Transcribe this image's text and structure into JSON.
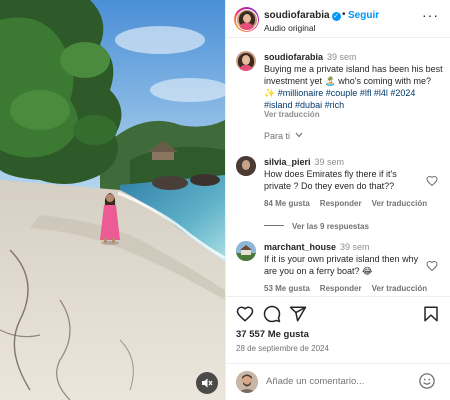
{
  "header": {
    "username": "soudiofarabia",
    "follow_label": "Seguir",
    "audio_label": "Audio original",
    "dot": "•",
    "more_label": "···"
  },
  "caption": {
    "username": "soudiofarabia",
    "time": "39 sem",
    "text_before": "Buying me a private island has been his best investment yet 🏝️ who's coming with me? ✨ ",
    "hashtags": [
      "#millionaire",
      "#couple",
      "#lfl",
      "#l4l",
      "#2024",
      "#island",
      "#dubai",
      "#rich"
    ],
    "translate_label": "Ver traducción"
  },
  "filter": {
    "label": "Para ti"
  },
  "comments": [
    {
      "username": "silvia_pieri",
      "time": "39 sem",
      "text": "How does Emirates fly there if it's private ? Do they even do that??",
      "likes": "84 Me gusta",
      "reply_label": "Responder",
      "translate_label": "Ver traducción",
      "view_replies": "Ver las 9 respuestas"
    },
    {
      "username": "marchant_house",
      "time": "39 sem",
      "text": "If it is your own private island then why are you on a ferry boat? 😂",
      "likes": "53 Me gusta",
      "reply_label": "Responder",
      "translate_label": "Ver traducción"
    }
  ],
  "actions": {
    "likes_count": "37 557 Me gusta",
    "date": "28 de septiembre de 2024"
  },
  "composer": {
    "placeholder": "Añade un comentario..."
  },
  "icons": {
    "like": "heart-icon",
    "comment": "comment-icon",
    "share": "share-icon",
    "save": "bookmark-icon",
    "emoji": "emoji-icon",
    "mute": "muted-speaker-icon",
    "verified": "verified-badge-icon"
  },
  "colors": {
    "accent": "#0095f6",
    "hashtag": "#00376b",
    "secondary_text": "#737373"
  }
}
